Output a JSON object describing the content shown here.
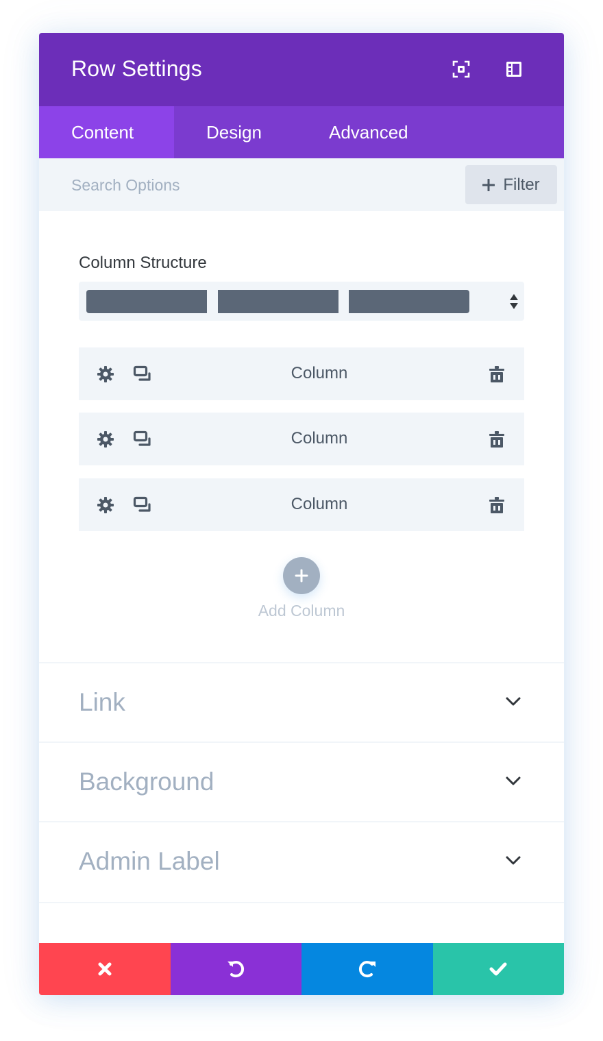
{
  "header": {
    "title": "Row Settings",
    "icons": [
      "expand-modal-icon",
      "sidebar-dock-icon"
    ]
  },
  "tabs": [
    {
      "label": "Content",
      "active": true
    },
    {
      "label": "Design",
      "active": false
    },
    {
      "label": "Advanced",
      "active": false
    }
  ],
  "search": {
    "placeholder": "Search Options",
    "value": "",
    "filter_label": "Filter",
    "filter_icon": "plus-icon"
  },
  "column_structure": {
    "label": "Column Structure",
    "selected_columns": 3
  },
  "columns": [
    {
      "label": "Column",
      "icons": [
        "gear-icon",
        "duplicate-icon",
        "trash-icon"
      ]
    },
    {
      "label": "Column",
      "icons": [
        "gear-icon",
        "duplicate-icon",
        "trash-icon"
      ]
    },
    {
      "label": "Column",
      "icons": [
        "gear-icon",
        "duplicate-icon",
        "trash-icon"
      ]
    }
  ],
  "add_column": {
    "label": "Add Column",
    "icon": "plus-icon"
  },
  "sections": [
    {
      "title": "Link",
      "icon": "chevron-down-icon"
    },
    {
      "title": "Background",
      "icon": "chevron-down-icon"
    },
    {
      "title": "Admin Label",
      "icon": "chevron-down-icon"
    }
  ],
  "footer": {
    "buttons": [
      {
        "name": "cancel",
        "icon": "close-icon",
        "color": "#ff4550"
      },
      {
        "name": "undo",
        "icon": "undo-icon",
        "color": "#8a30d6"
      },
      {
        "name": "redo",
        "icon": "redo-icon",
        "color": "#0587e0"
      },
      {
        "name": "save",
        "icon": "check-icon",
        "color": "#29c4a9"
      }
    ]
  },
  "colors": {
    "header": "#6c2eb9",
    "tabs_bar": "#7b3bcf",
    "tab_active": "#8c43e8",
    "panel_bg": "#f1f5f9",
    "text_dark": "#32373c",
    "text_muted": "#a2b0c1"
  }
}
